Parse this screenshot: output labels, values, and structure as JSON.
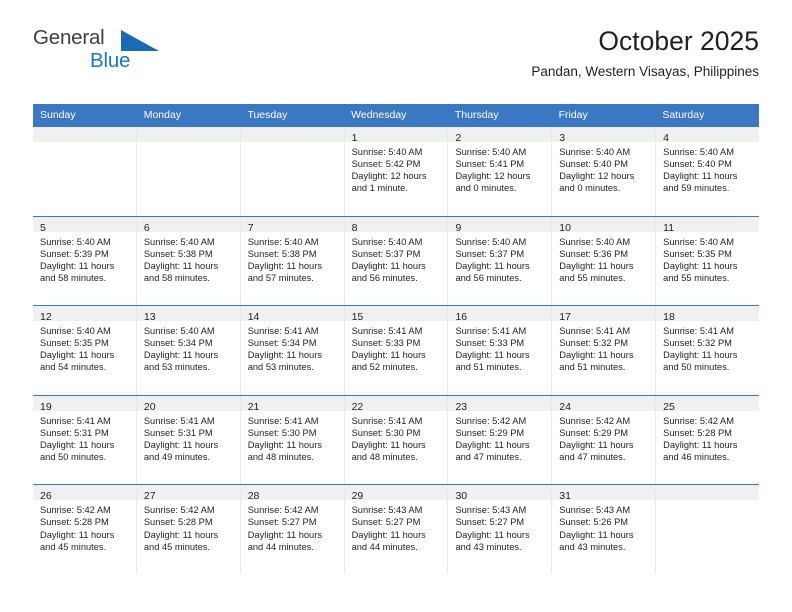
{
  "brand": {
    "name_part1": "General",
    "name_part2": "Blue",
    "triangle_icon": "triangle-icon",
    "color_dark": "#3f3f3f",
    "color_blue": "#1577cf"
  },
  "header": {
    "title": "October 2025",
    "subtitle": "Pandan, Western Visayas, Philippines",
    "weekday_bg": "#3b78c3",
    "weekday_text": "#ffffff"
  },
  "weekdays": [
    "Sunday",
    "Monday",
    "Tuesday",
    "Wednesday",
    "Thursday",
    "Friday",
    "Saturday"
  ],
  "labels": {
    "sunrise": "Sunrise:",
    "sunset": "Sunset:",
    "daylight": "Daylight:"
  },
  "weeks": [
    [
      {
        "day": "",
        "sunrise": "",
        "sunset": "",
        "daylight_line1": "",
        "daylight_line2": ""
      },
      {
        "day": "",
        "sunrise": "",
        "sunset": "",
        "daylight_line1": "",
        "daylight_line2": ""
      },
      {
        "day": "",
        "sunrise": "",
        "sunset": "",
        "daylight_line1": "",
        "daylight_line2": ""
      },
      {
        "day": "1",
        "sunrise": "Sunrise: 5:40 AM",
        "sunset": "Sunset: 5:42 PM",
        "daylight_line1": "Daylight: 12 hours",
        "daylight_line2": "and 1 minute."
      },
      {
        "day": "2",
        "sunrise": "Sunrise: 5:40 AM",
        "sunset": "Sunset: 5:41 PM",
        "daylight_line1": "Daylight: 12 hours",
        "daylight_line2": "and 0 minutes."
      },
      {
        "day": "3",
        "sunrise": "Sunrise: 5:40 AM",
        "sunset": "Sunset: 5:40 PM",
        "daylight_line1": "Daylight: 12 hours",
        "daylight_line2": "and 0 minutes."
      },
      {
        "day": "4",
        "sunrise": "Sunrise: 5:40 AM",
        "sunset": "Sunset: 5:40 PM",
        "daylight_line1": "Daylight: 11 hours",
        "daylight_line2": "and 59 minutes."
      }
    ],
    [
      {
        "day": "5",
        "sunrise": "Sunrise: 5:40 AM",
        "sunset": "Sunset: 5:39 PM",
        "daylight_line1": "Daylight: 11 hours",
        "daylight_line2": "and 58 minutes."
      },
      {
        "day": "6",
        "sunrise": "Sunrise: 5:40 AM",
        "sunset": "Sunset: 5:38 PM",
        "daylight_line1": "Daylight: 11 hours",
        "daylight_line2": "and 58 minutes."
      },
      {
        "day": "7",
        "sunrise": "Sunrise: 5:40 AM",
        "sunset": "Sunset: 5:38 PM",
        "daylight_line1": "Daylight: 11 hours",
        "daylight_line2": "and 57 minutes."
      },
      {
        "day": "8",
        "sunrise": "Sunrise: 5:40 AM",
        "sunset": "Sunset: 5:37 PM",
        "daylight_line1": "Daylight: 11 hours",
        "daylight_line2": "and 56 minutes."
      },
      {
        "day": "9",
        "sunrise": "Sunrise: 5:40 AM",
        "sunset": "Sunset: 5:37 PM",
        "daylight_line1": "Daylight: 11 hours",
        "daylight_line2": "and 56 minutes."
      },
      {
        "day": "10",
        "sunrise": "Sunrise: 5:40 AM",
        "sunset": "Sunset: 5:36 PM",
        "daylight_line1": "Daylight: 11 hours",
        "daylight_line2": "and 55 minutes."
      },
      {
        "day": "11",
        "sunrise": "Sunrise: 5:40 AM",
        "sunset": "Sunset: 5:35 PM",
        "daylight_line1": "Daylight: 11 hours",
        "daylight_line2": "and 55 minutes."
      }
    ],
    [
      {
        "day": "12",
        "sunrise": "Sunrise: 5:40 AM",
        "sunset": "Sunset: 5:35 PM",
        "daylight_line1": "Daylight: 11 hours",
        "daylight_line2": "and 54 minutes."
      },
      {
        "day": "13",
        "sunrise": "Sunrise: 5:40 AM",
        "sunset": "Sunset: 5:34 PM",
        "daylight_line1": "Daylight: 11 hours",
        "daylight_line2": "and 53 minutes."
      },
      {
        "day": "14",
        "sunrise": "Sunrise: 5:41 AM",
        "sunset": "Sunset: 5:34 PM",
        "daylight_line1": "Daylight: 11 hours",
        "daylight_line2": "and 53 minutes."
      },
      {
        "day": "15",
        "sunrise": "Sunrise: 5:41 AM",
        "sunset": "Sunset: 5:33 PM",
        "daylight_line1": "Daylight: 11 hours",
        "daylight_line2": "and 52 minutes."
      },
      {
        "day": "16",
        "sunrise": "Sunrise: 5:41 AM",
        "sunset": "Sunset: 5:33 PM",
        "daylight_line1": "Daylight: 11 hours",
        "daylight_line2": "and 51 minutes."
      },
      {
        "day": "17",
        "sunrise": "Sunrise: 5:41 AM",
        "sunset": "Sunset: 5:32 PM",
        "daylight_line1": "Daylight: 11 hours",
        "daylight_line2": "and 51 minutes."
      },
      {
        "day": "18",
        "sunrise": "Sunrise: 5:41 AM",
        "sunset": "Sunset: 5:32 PM",
        "daylight_line1": "Daylight: 11 hours",
        "daylight_line2": "and 50 minutes."
      }
    ],
    [
      {
        "day": "19",
        "sunrise": "Sunrise: 5:41 AM",
        "sunset": "Sunset: 5:31 PM",
        "daylight_line1": "Daylight: 11 hours",
        "daylight_line2": "and 50 minutes."
      },
      {
        "day": "20",
        "sunrise": "Sunrise: 5:41 AM",
        "sunset": "Sunset: 5:31 PM",
        "daylight_line1": "Daylight: 11 hours",
        "daylight_line2": "and 49 minutes."
      },
      {
        "day": "21",
        "sunrise": "Sunrise: 5:41 AM",
        "sunset": "Sunset: 5:30 PM",
        "daylight_line1": "Daylight: 11 hours",
        "daylight_line2": "and 48 minutes."
      },
      {
        "day": "22",
        "sunrise": "Sunrise: 5:41 AM",
        "sunset": "Sunset: 5:30 PM",
        "daylight_line1": "Daylight: 11 hours",
        "daylight_line2": "and 48 minutes."
      },
      {
        "day": "23",
        "sunrise": "Sunrise: 5:42 AM",
        "sunset": "Sunset: 5:29 PM",
        "daylight_line1": "Daylight: 11 hours",
        "daylight_line2": "and 47 minutes."
      },
      {
        "day": "24",
        "sunrise": "Sunrise: 5:42 AM",
        "sunset": "Sunset: 5:29 PM",
        "daylight_line1": "Daylight: 11 hours",
        "daylight_line2": "and 47 minutes."
      },
      {
        "day": "25",
        "sunrise": "Sunrise: 5:42 AM",
        "sunset": "Sunset: 5:28 PM",
        "daylight_line1": "Daylight: 11 hours",
        "daylight_line2": "and 46 minutes."
      }
    ],
    [
      {
        "day": "26",
        "sunrise": "Sunrise: 5:42 AM",
        "sunset": "Sunset: 5:28 PM",
        "daylight_line1": "Daylight: 11 hours",
        "daylight_line2": "and 45 minutes."
      },
      {
        "day": "27",
        "sunrise": "Sunrise: 5:42 AM",
        "sunset": "Sunset: 5:28 PM",
        "daylight_line1": "Daylight: 11 hours",
        "daylight_line2": "and 45 minutes."
      },
      {
        "day": "28",
        "sunrise": "Sunrise: 5:42 AM",
        "sunset": "Sunset: 5:27 PM",
        "daylight_line1": "Daylight: 11 hours",
        "daylight_line2": "and 44 minutes."
      },
      {
        "day": "29",
        "sunrise": "Sunrise: 5:43 AM",
        "sunset": "Sunset: 5:27 PM",
        "daylight_line1": "Daylight: 11 hours",
        "daylight_line2": "and 44 minutes."
      },
      {
        "day": "30",
        "sunrise": "Sunrise: 5:43 AM",
        "sunset": "Sunset: 5:27 PM",
        "daylight_line1": "Daylight: 11 hours",
        "daylight_line2": "and 43 minutes."
      },
      {
        "day": "31",
        "sunrise": "Sunrise: 5:43 AM",
        "sunset": "Sunset: 5:26 PM",
        "daylight_line1": "Daylight: 11 hours",
        "daylight_line2": "and 43 minutes."
      },
      {
        "day": "",
        "sunrise": "",
        "sunset": "",
        "daylight_line1": "",
        "daylight_line2": ""
      }
    ]
  ]
}
